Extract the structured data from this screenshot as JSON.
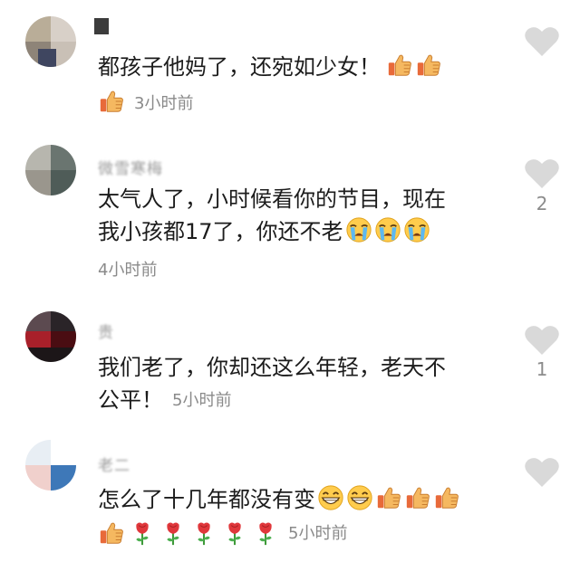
{
  "comments": [
    {
      "username": "",
      "text": "都孩子他妈了，还宛如少女！",
      "text_emojis": [
        "thumbs-up",
        "thumbs-up"
      ],
      "line2_emojis": [
        "thumbs-up"
      ],
      "time": "3小时前",
      "likes": ""
    },
    {
      "username": "微雪寒梅",
      "text_line1": "太气人了，小时候看你的节目，现在",
      "text_line2": "我小孩都17了，你还不老",
      "text_emojis": [
        "crying-face",
        "crying-face",
        "crying-face"
      ],
      "time": "4小时前",
      "likes": "2"
    },
    {
      "username": "贵",
      "text_line1": "我们老了，你却还这么年轻，老天不",
      "text_line2": "公平！",
      "time": "5小时前",
      "likes": "1"
    },
    {
      "username": "老二",
      "text": "怎么了十几年都没有变",
      "text_emojis": [
        "grinning-face",
        "grinning-face",
        "thumbs-up",
        "thumbs-up",
        "thumbs-up"
      ],
      "line2_emojis": [
        "thumbs-up",
        "rose",
        "rose",
        "rose",
        "rose",
        "rose"
      ],
      "time": "5小时前",
      "likes": ""
    }
  ],
  "colors": {
    "text": "#1c1c1c",
    "meta": "#8a8a8a",
    "heart": "#d9d9d9",
    "thumb": "#f1b45b",
    "rose": "#e0373b"
  }
}
